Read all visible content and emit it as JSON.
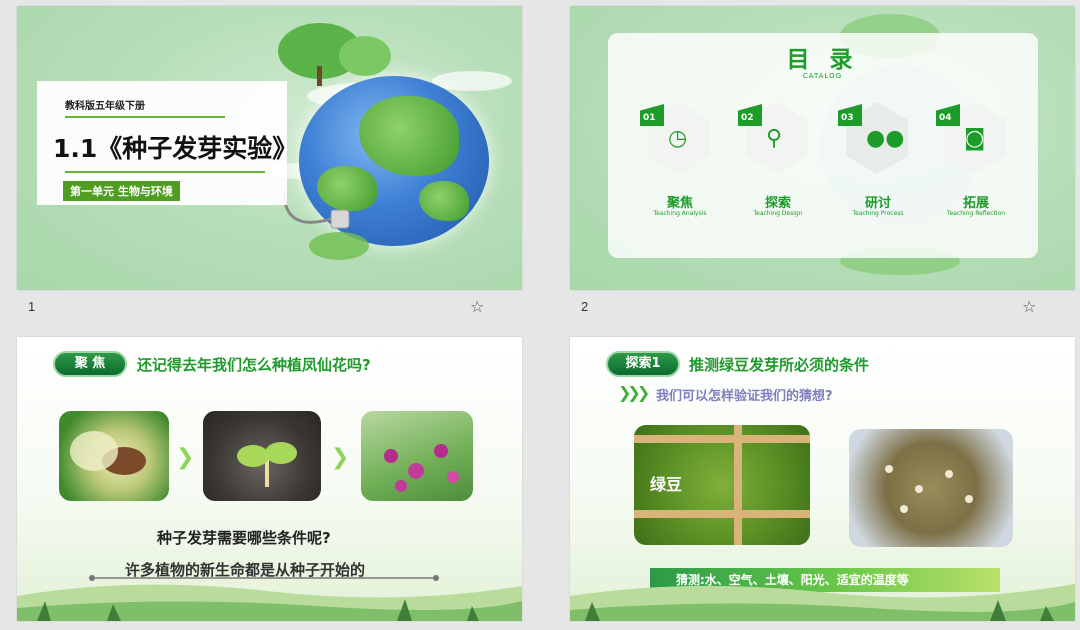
{
  "colors": {
    "accent_green": "#1e9c2a",
    "panel_bg": "#e6e6e6"
  },
  "slides": [
    {
      "number": "1",
      "grade": "教科版五年级下册",
      "title": "1.1《种子发芽实验》",
      "unit": "第一单元 生物与环境",
      "star_icon": "star-outline-icon"
    },
    {
      "number": "2",
      "title": "目 录",
      "subtitle": "CATALOG",
      "items": [
        {
          "num": "01",
          "label": "聚焦",
          "en": "Teaching Analysis",
          "icon": "clock-icon"
        },
        {
          "num": "02",
          "label": "探索",
          "en": "Teaching Design",
          "icon": "magnifier-icon"
        },
        {
          "num": "03",
          "label": "研讨",
          "en": "Teaching Process",
          "icon": "people-icon"
        },
        {
          "num": "04",
          "label": "拓展",
          "en": "Teaching Reflection",
          "icon": "camera-icon"
        }
      ],
      "star_icon": "star-outline-icon"
    },
    {
      "tag": "聚 焦",
      "heading": "还记得去年我们怎么种植凤仙花吗?",
      "question": "种子发芽需要哪些条件呢?",
      "statement": "许多植物的新生命都是从种子开始的",
      "photos": [
        "seed-photo",
        "sprout-photo",
        "flower-photo"
      ]
    },
    {
      "tag": "探索1",
      "heading": "推测绿豆发芽所必须的条件",
      "subheading": "我们可以怎样验证我们的猜想?",
      "photo_label": "绿豆",
      "guess": "猜测:水、空气、土壤、阳光、适宜的温度等"
    }
  ]
}
